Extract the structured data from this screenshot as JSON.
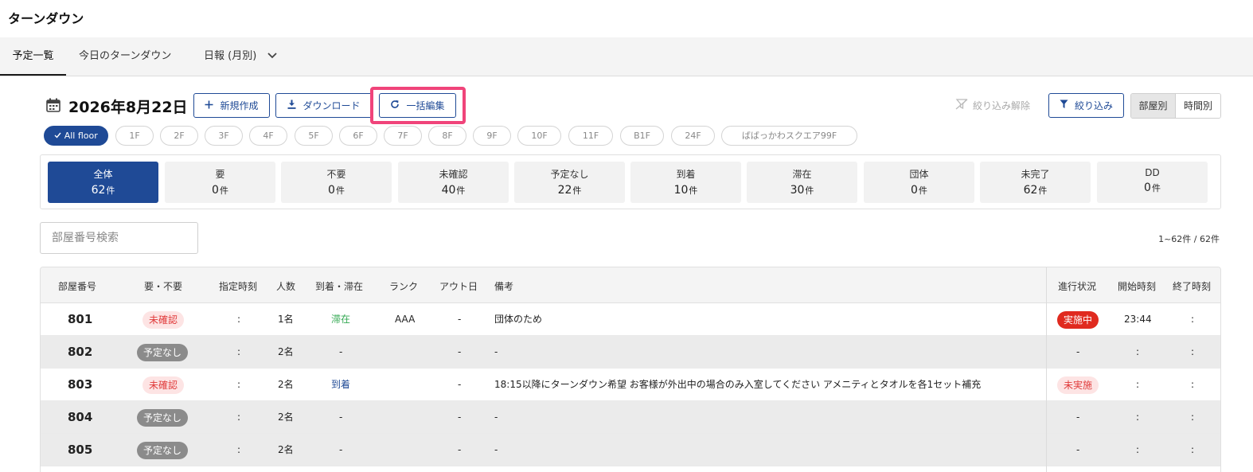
{
  "app": {
    "title": "ターンダウン"
  },
  "tabs": [
    {
      "label": "予定一覧"
    },
    {
      "label": "今日のターンダウン"
    },
    {
      "label": "日報 (月別)"
    }
  ],
  "toolbar": {
    "date": "2026年8月22日",
    "new_label": "新規作成",
    "download_label": "ダウンロード",
    "bulk_edit_label": "一括編集",
    "clear_filter_label": "絞り込み解除",
    "filter_label": "絞り込み",
    "view_by_room": "部屋別",
    "view_by_time": "時間別"
  },
  "floors": [
    "All floor",
    "1F",
    "2F",
    "3F",
    "4F",
    "5F",
    "6F",
    "7F",
    "8F",
    "9F",
    "10F",
    "11F",
    "B1F",
    "24F",
    "ばばっかわスクエア99F"
  ],
  "stats": [
    {
      "label": "全体",
      "count": "62",
      "unit": "件"
    },
    {
      "label": "要",
      "count": "0",
      "unit": "件"
    },
    {
      "label": "不要",
      "count": "0",
      "unit": "件"
    },
    {
      "label": "未確認",
      "count": "40",
      "unit": "件"
    },
    {
      "label": "予定なし",
      "count": "22",
      "unit": "件"
    },
    {
      "label": "到着",
      "count": "10",
      "unit": "件"
    },
    {
      "label": "滞在",
      "count": "30",
      "unit": "件"
    },
    {
      "label": "団体",
      "count": "0",
      "unit": "件"
    },
    {
      "label": "未完了",
      "count": "62",
      "unit": "件"
    },
    {
      "label": "DD",
      "count": "0",
      "unit": "件"
    }
  ],
  "search": {
    "placeholder": "部屋番号検索"
  },
  "count_info": "1~62件 / 62件",
  "table": {
    "headers": {
      "room": "部屋番号",
      "need": "要・不要",
      "time": "指定時刻",
      "people": "人数",
      "arrival": "到着・滞在",
      "rank": "ランク",
      "out": "アウト日",
      "note": "備考",
      "progress": "進行状況",
      "start": "開始時刻",
      "end": "終了時刻"
    },
    "rows": [
      {
        "room": "801",
        "need": "未確認",
        "time": ":",
        "people": "1名",
        "arrival": "滞在",
        "rank": "AAA",
        "out": "-",
        "note": "団体のため",
        "progress": "実施中",
        "start": "23:44",
        "end": ":"
      },
      {
        "room": "802",
        "need": "予定なし",
        "time": ":",
        "people": "2名",
        "arrival": "-",
        "rank": "",
        "out": "-",
        "note": "-",
        "progress": "-",
        "start": ":",
        "end": ":"
      },
      {
        "room": "803",
        "need": "未確認",
        "time": ":",
        "people": "2名",
        "arrival": "到着",
        "rank": "",
        "out": "-",
        "note": "18:15以降にターンダウン希望 お客様が外出中の場合のみ入室してください アメニティとタオルを各1セット補充",
        "progress": "未実施",
        "start": ":",
        "end": ":"
      },
      {
        "room": "804",
        "need": "予定なし",
        "time": ":",
        "people": "2名",
        "arrival": "-",
        "rank": "",
        "out": "-",
        "note": "-",
        "progress": "-",
        "start": ":",
        "end": ":"
      },
      {
        "room": "805",
        "need": "予定なし",
        "time": ":",
        "people": "2名",
        "arrival": "-",
        "rank": "",
        "out": "-",
        "note": "-",
        "progress": "-",
        "start": ":",
        "end": ":"
      }
    ]
  },
  "colors": {
    "primary": "#1f4a96",
    "highlight": "#f0447a",
    "danger": "#e02a1f",
    "badge_gray": "#8b8b8b",
    "stay_green": "#33a852"
  }
}
